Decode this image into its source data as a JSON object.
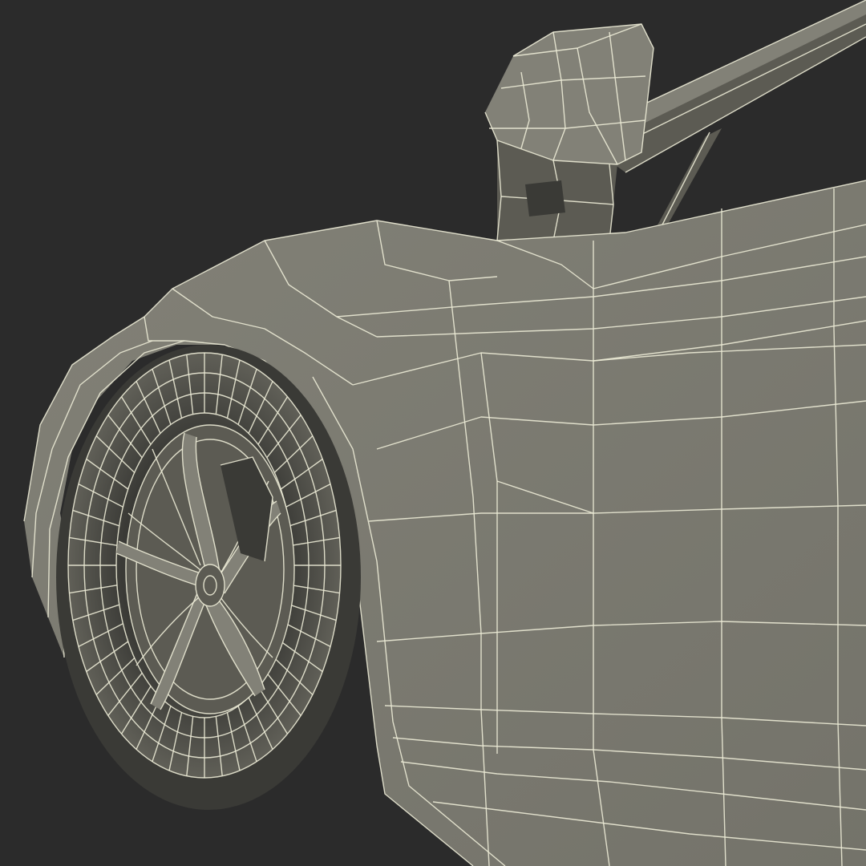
{
  "scene": {
    "subject": "car-front-wheel-wireframe-render",
    "colors": {
      "background": "#2b2b2b",
      "body_fill": "#74736a",
      "body_light": "#828177",
      "body_dark": "#5c5b53",
      "shadow": "#3a3a36",
      "tire_fill": "#6a6960",
      "wire": "#ecebd6"
    }
  }
}
